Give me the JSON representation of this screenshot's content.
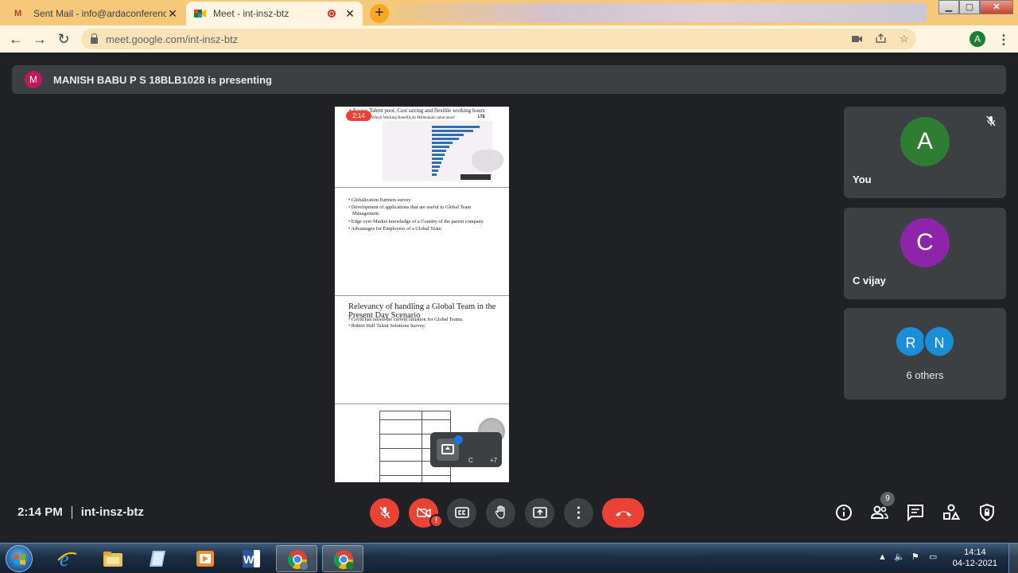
{
  "browser": {
    "tabs": [
      {
        "title": "Sent Mail - info@ardaconference",
        "favicon": "gmail-icon",
        "active": false
      },
      {
        "title": "Meet - int-insz-btz",
        "favicon": "meet-icon",
        "active": true
      }
    ],
    "url": "meet.google.com/int-insz-btz",
    "profile_initial": "A"
  },
  "meet": {
    "presenter_initial": "M",
    "presenting_banner": "MANISH BABU P S 18BLB1028 is presenting",
    "time": "2:14 PM",
    "meeting_code": "int-insz-btz",
    "participant_count": "9",
    "video_badge": "!",
    "participants": [
      {
        "initial": "A",
        "name": "You",
        "color": "#2e7d32",
        "muted": true
      },
      {
        "initial": "C",
        "name": "C vijay",
        "color": "#8e24aa",
        "muted": false
      }
    ],
    "others": {
      "initials": [
        "R",
        "N"
      ],
      "label": "6 others"
    },
    "self_view": {
      "name_initial": "C",
      "more": "+7"
    }
  },
  "slides": {
    "timer": "2:14",
    "slide1": {
      "heading": "• Access Talent pool, Cost saving and flexible working hours",
      "chart_title": "Which Working Benefits do Millennials value most?",
      "overlay": "LTE"
    },
    "slide2": {
      "bullets": [
        "• Globalization Partners survey",
        "• Development of applications that are useful to Global Team Management.",
        "• Edge over Market knowledge of a Country of the parent company",
        "• Advantages for Employees of a Global Team"
      ]
    },
    "slide3": {
      "title": "Relevancy of handling a Global Team in the Present Day Scenario",
      "bullets": [
        "• Covid has raised the current situation for Global Teams.",
        "• Robert Half Talent Solutions Survey:"
      ]
    }
  },
  "taskbar": {
    "clock_time": "14:14",
    "clock_date": "04-12-2021"
  }
}
